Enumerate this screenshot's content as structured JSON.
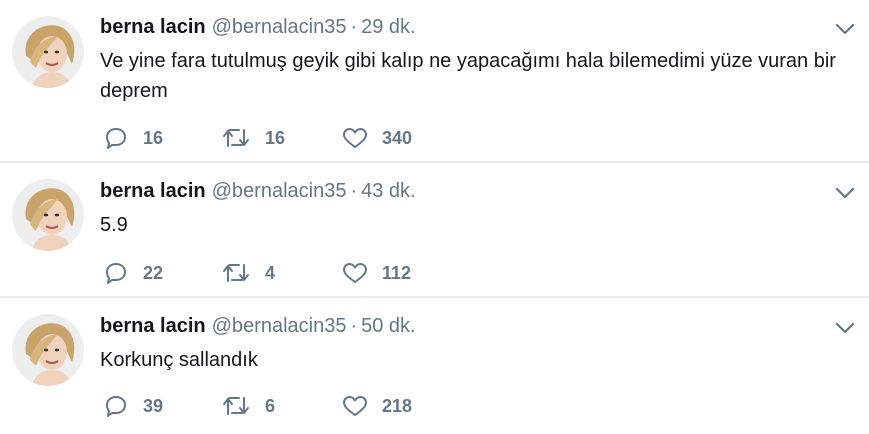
{
  "tweets": [
    {
      "name": "berna lacin",
      "handle": "@bernalacin35",
      "dot": "·",
      "time": "29 dk.",
      "text": "Ve yine fara tutulmuş geyik gibi kalıp ne yapacağımı hala bilemedimi yüze vuran bir deprem",
      "replies": "16",
      "retweets": "16",
      "likes": "340"
    },
    {
      "name": "berna lacin",
      "handle": "@bernalacin35",
      "dot": "·",
      "time": "43 dk.",
      "text": "5.9",
      "replies": "22",
      "retweets": "4",
      "likes": "112"
    },
    {
      "name": "berna lacin",
      "handle": "@bernalacin35",
      "dot": "·",
      "time": "50 dk.",
      "text": "Korkunç sallandık",
      "replies": "39",
      "retweets": "6",
      "likes": "218"
    }
  ],
  "icons": {
    "reply": "reply-icon",
    "retweet": "retweet-icon",
    "like": "heart-icon",
    "caret": "chevron-down-icon"
  },
  "colors": {
    "text": "#14171a",
    "muted": "#657786",
    "divider": "#e6ecf0"
  }
}
